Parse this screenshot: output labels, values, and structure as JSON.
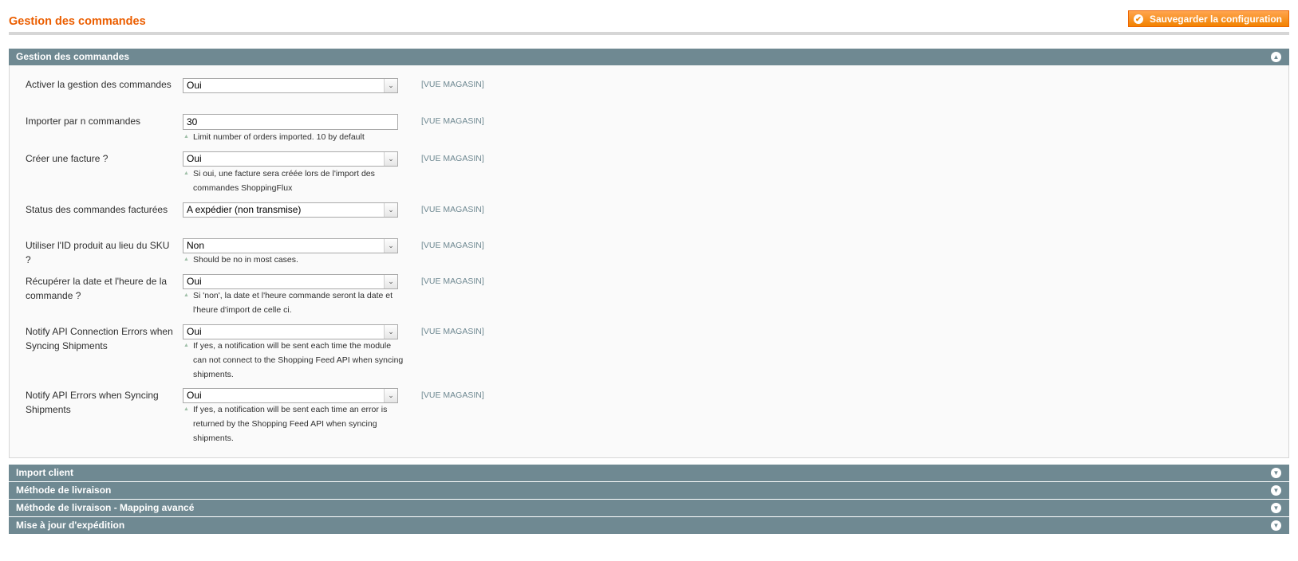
{
  "header": {
    "title": "Gestion des commandes",
    "save_label": "Sauvegarder la configuration"
  },
  "main_section": {
    "title": "Gestion des commandes",
    "scope_label": "[VUE MAGASIN]",
    "rows": [
      {
        "label": "Activer la gestion des commandes",
        "value": "Oui"
      },
      {
        "label": "Importer par n commandes",
        "value": "30",
        "note": "Limit number of orders imported. 10 by default"
      },
      {
        "label": "Créer une facture ?",
        "value": "Oui",
        "note": "Si oui, une facture sera créée lors de l'import des commandes ShoppingFlux"
      },
      {
        "label": "Status des commandes facturées",
        "value": "A expédier (non transmise)"
      },
      {
        "label": "Utiliser l'ID produit au lieu du SKU ?",
        "value": "Non",
        "note": "Should be no in most cases."
      },
      {
        "label": "Récupérer la date et l'heure de la commande ?",
        "value": "Oui",
        "note": "Si 'non', la date et l'heure commande seront la date et l'heure d'import de celle ci."
      },
      {
        "label": "Notify API Connection Errors when Syncing Shipments",
        "value": "Oui",
        "note": "If yes, a notification will be sent each time the module can not connect to the Shopping Feed API when syncing shipments."
      },
      {
        "label": "Notify API Errors when Syncing Shipments",
        "value": "Oui",
        "note": "If yes, a notification will be sent each time an error is returned by the Shopping Feed API when syncing shipments."
      }
    ]
  },
  "collapsed_sections": [
    {
      "title": "Import client"
    },
    {
      "title": "Méthode de livraison"
    },
    {
      "title": "Méthode de livraison - Mapping avancé"
    },
    {
      "title": "Mise à jour d'expédition"
    }
  ],
  "icons": {
    "save": "check-circle-icon",
    "collapse": "chevron-up-circle-icon",
    "expand": "chevron-down-circle-icon",
    "note": "triangle-note-icon",
    "select_arrow": "dropdown-arrow-icon"
  },
  "colors": {
    "title_orange": "#eb5e00",
    "button_orange": "#f18200",
    "section_header": "#6f8992",
    "scope_text": "#6f8992"
  }
}
